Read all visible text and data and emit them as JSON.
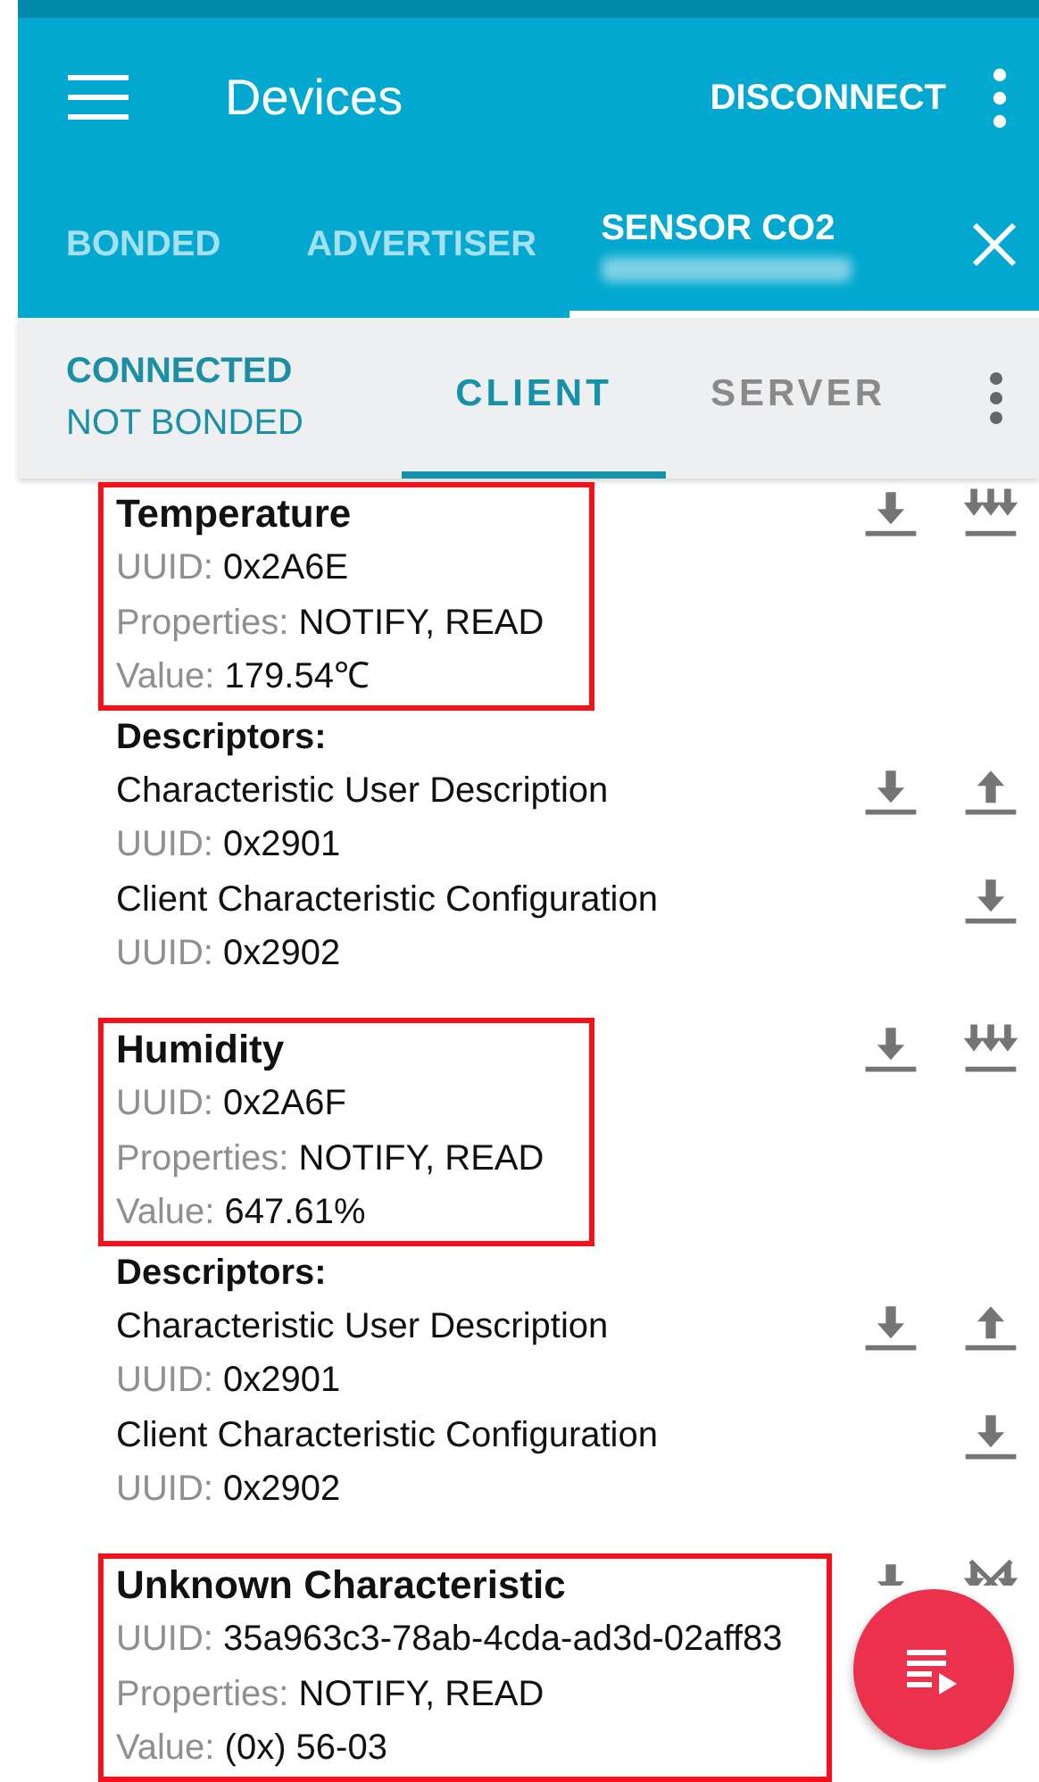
{
  "toolbar": {
    "title": "Devices",
    "action": "DISCONNECT"
  },
  "device_tabs": [
    {
      "label": "BONDED",
      "selected": false
    },
    {
      "label": "ADVERTISER",
      "selected": false
    },
    {
      "label": "SENSOR CO2",
      "selected": true
    }
  ],
  "connection": {
    "state": "CONNECTED",
    "bond": "NOT BONDED"
  },
  "mode_tabs": [
    {
      "label": "CLIENT",
      "selected": true
    },
    {
      "label": "SERVER",
      "selected": false
    }
  ],
  "characteristics": [
    {
      "name": "Temperature",
      "highlighted": true,
      "uuid_label": "UUID:",
      "uuid": "0x2A6E",
      "properties_label": "Properties:",
      "properties": "NOTIFY, READ",
      "value_label": "Value:",
      "value": "179.54℃",
      "actions": [
        {
          "kind": "read"
        },
        {
          "kind": "notify"
        }
      ],
      "descriptors_label": "Descriptors:",
      "descriptors": [
        {
          "name": "Characteristic User Description",
          "uuid_label": "UUID:",
          "uuid": "0x2901",
          "actions": [
            {
              "kind": "read"
            },
            {
              "kind": "write"
            }
          ]
        },
        {
          "name": "Client Characteristic Configuration",
          "uuid_label": "UUID:",
          "uuid": "0x2902",
          "actions": [
            {
              "kind": "read"
            }
          ]
        }
      ]
    },
    {
      "name": "Humidity",
      "highlighted": true,
      "uuid_label": "UUID:",
      "uuid": "0x2A6F",
      "properties_label": "Properties:",
      "properties": "NOTIFY, READ",
      "value_label": "Value:",
      "value": "647.61%",
      "actions": [
        {
          "kind": "read"
        },
        {
          "kind": "notify"
        }
      ],
      "descriptors_label": "Descriptors:",
      "descriptors": [
        {
          "name": "Characteristic User Description",
          "uuid_label": "UUID:",
          "uuid": "0x2901",
          "actions": [
            {
              "kind": "read"
            },
            {
              "kind": "write"
            }
          ]
        },
        {
          "name": "Client Characteristic Configuration",
          "uuid_label": "UUID:",
          "uuid": "0x2902",
          "actions": [
            {
              "kind": "read"
            }
          ]
        }
      ]
    },
    {
      "name": "Unknown Characteristic",
      "highlighted": true,
      "uuid_label": "UUID:",
      "uuid": "35a963c3-78ab-4cda-ad3d-02aff83",
      "properties_label": "Properties:",
      "properties": "NOTIFY, READ",
      "value_label": "Value:",
      "value": "(0x) 56-03",
      "actions": [
        {
          "kind": "read"
        },
        {
          "kind": "notify_off"
        }
      ]
    }
  ]
}
